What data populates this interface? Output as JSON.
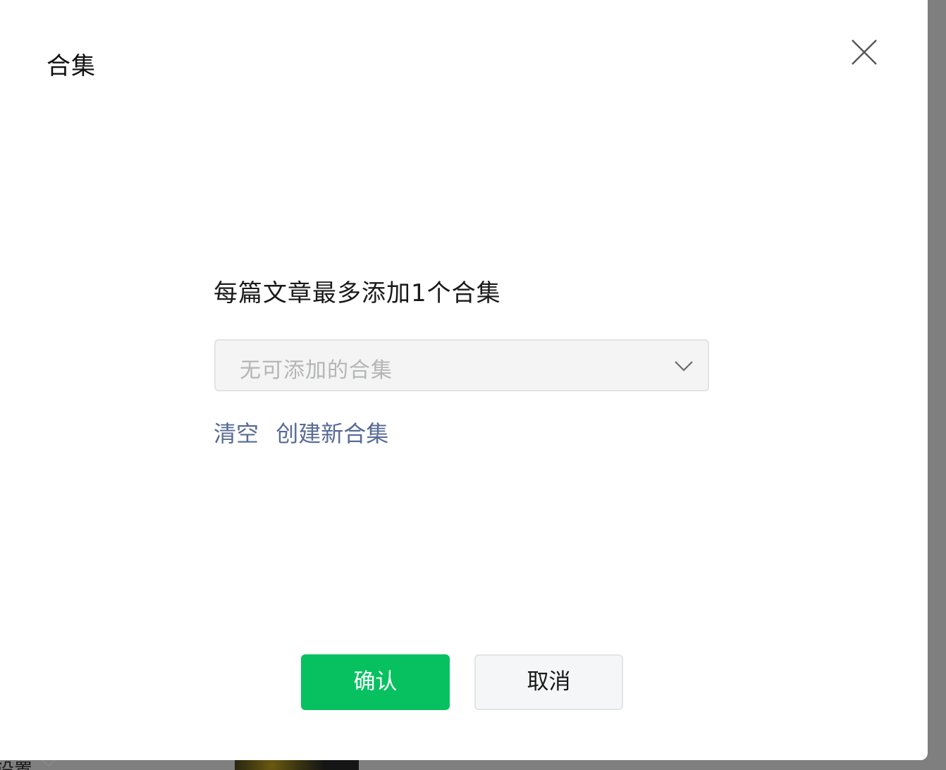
{
  "modal": {
    "title": "合集",
    "hint": "每篇文章最多添加1个合集",
    "select": {
      "placeholder": "无可添加的合集"
    },
    "links": {
      "clear": "清空",
      "create": "创建新合集"
    },
    "buttons": {
      "confirm": "确认",
      "cancel": "取消"
    },
    "colors": {
      "primary": "#07c160",
      "link": "#576b95"
    }
  },
  "background_page": {
    "partial_label": "设置"
  }
}
